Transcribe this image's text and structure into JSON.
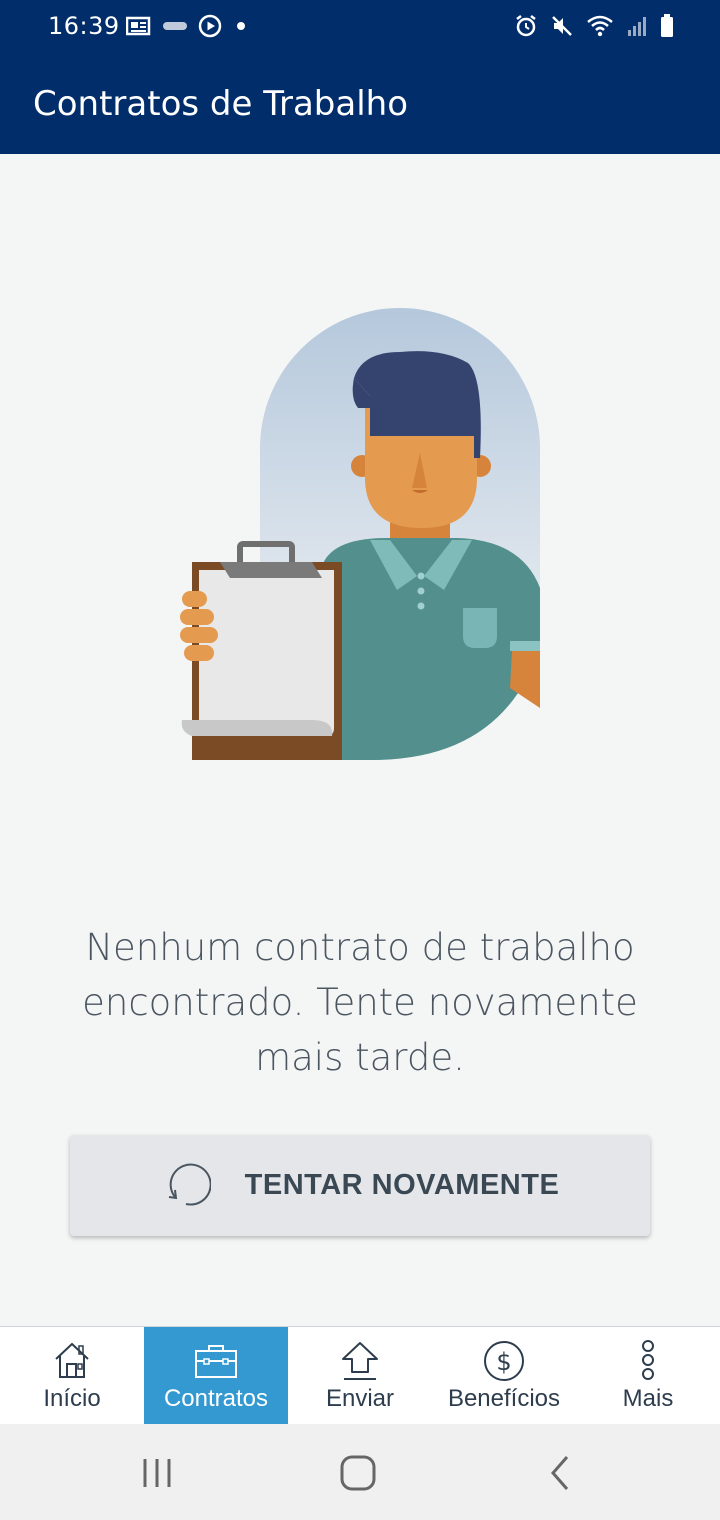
{
  "status_bar": {
    "time": "16:39",
    "icons_left": [
      "news-icon",
      "gopay-icon",
      "play-circle-icon",
      "dot-icon"
    ],
    "icons_right": [
      "alarm-icon",
      "mute-icon",
      "wifi-icon",
      "signal-icon",
      "battery-icon"
    ]
  },
  "app_bar": {
    "title": "Contratos de Trabalho"
  },
  "illustration": {
    "subject": "person-with-clipboard"
  },
  "empty_state": {
    "message": "Nenhum contrato de trabalho encontrado. Tente novamente mais tarde.",
    "retry_label": "TENTAR NOVAMENTE"
  },
  "bottom_nav": {
    "items": [
      {
        "label": "Início",
        "icon": "home-icon",
        "active": false
      },
      {
        "label": "Contratos",
        "icon": "briefcase-icon",
        "active": true
      },
      {
        "label": "Enviar",
        "icon": "upload-arrow-icon",
        "active": false
      },
      {
        "label": "Benefícios",
        "icon": "dollar-circle-icon",
        "active": false
      },
      {
        "label": "Mais",
        "icon": "more-vertical-icon",
        "active": false
      }
    ]
  },
  "colors": {
    "header": "#012d6b",
    "active_tab": "#3399d0",
    "background": "#f4f5f5",
    "button": "#e4e6ea",
    "text": "#4b5661"
  }
}
